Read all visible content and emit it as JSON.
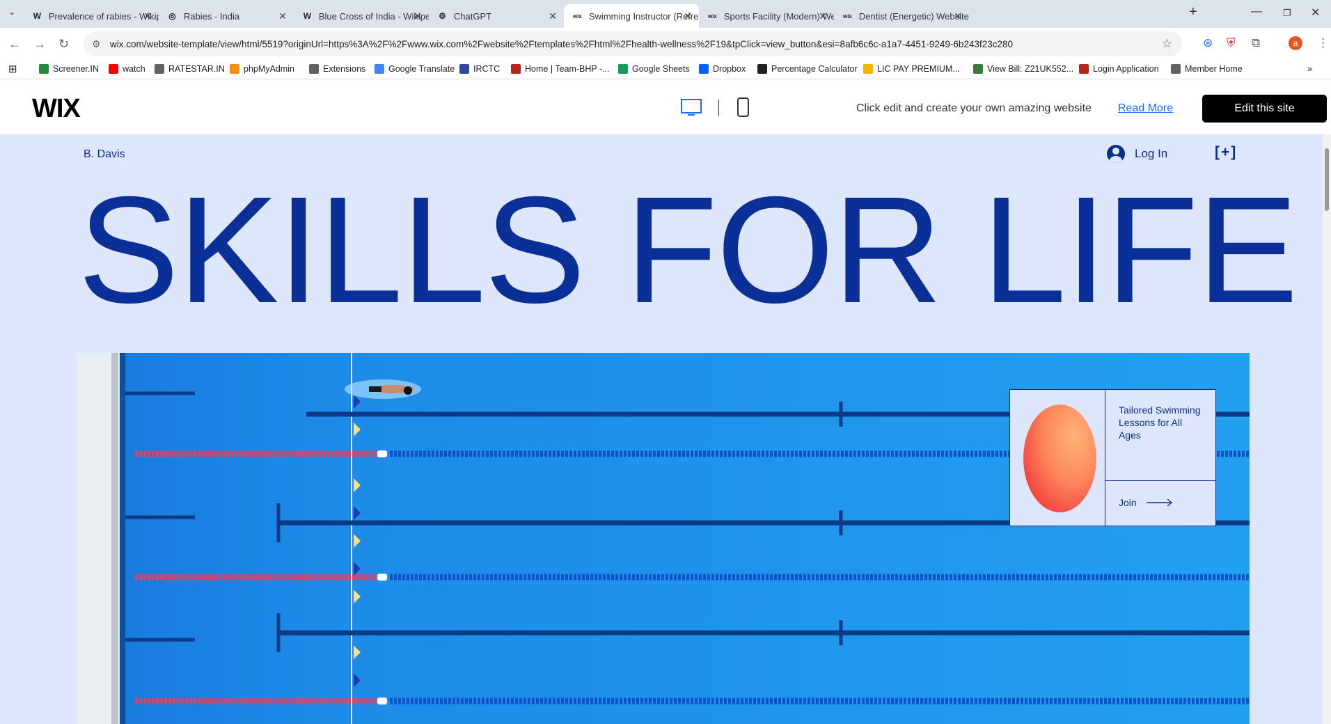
{
  "browser": {
    "tabs": [
      {
        "title": "Prevalence of rabies - Wikipedia",
        "icon": "wikipedia-icon",
        "glyph": "W"
      },
      {
        "title": "Rabies - India",
        "icon": "globe-icon",
        "glyph": "◎"
      },
      {
        "title": "Blue Cross of India - Wikipedia",
        "icon": "wikipedia-icon",
        "glyph": "W"
      },
      {
        "title": "ChatGPT",
        "icon": "chatgpt-icon",
        "glyph": "⚙"
      },
      {
        "title": "Swimming Instructor (Refreshing)",
        "icon": "wix-icon",
        "glyph": "wix",
        "active": true
      },
      {
        "title": "Sports Facility (Modern) Website",
        "icon": "wix-icon",
        "glyph": "wix"
      },
      {
        "title": "Dentist (Energetic) Website Template",
        "icon": "wix-icon",
        "glyph": "wix"
      }
    ],
    "url": "wix.com/website-template/view/html/5519?originUrl=https%3A%2F%2Fwww.wix.com%2Fwebsite%2Ftemplates%2Fhtml%2Fhealth-wellness%2F19&tpClick=view_button&esi=8afb6c6c-a1a7-4451-9249-6b243f23c280",
    "profile_initial": "a",
    "bookmarks": [
      {
        "label": "Screener.IN",
        "color": "#1e8e3e"
      },
      {
        "label": "watch",
        "color": "#ff0000"
      },
      {
        "label": "RATESTAR.IN",
        "color": "#5f6368"
      },
      {
        "label": "phpMyAdmin",
        "color": "#f29111"
      },
      {
        "label": "Extensions",
        "color": "#5f6368"
      },
      {
        "label": "Google Translate",
        "color": "#4285f4"
      },
      {
        "label": "IRCTC",
        "color": "#2b4a9b"
      },
      {
        "label": "Home | Team-BHP -...",
        "color": "#b3261e"
      },
      {
        "label": "Google Sheets",
        "color": "#0f9d58"
      },
      {
        "label": "Dropbox",
        "color": "#0061ff"
      },
      {
        "label": "Percentage Calculator",
        "color": "#202124"
      },
      {
        "label": "LIC PAY PREMIUM...",
        "color": "#f4b400"
      },
      {
        "label": "View Bill: Z21UK552...",
        "color": "#3b7a3b"
      },
      {
        "label": "Login Application",
        "color": "#b3261e"
      },
      {
        "label": "Member Home",
        "color": "#5f6368"
      }
    ]
  },
  "wix": {
    "logo": "WIX",
    "message": "Click edit and create your own amazing website",
    "read_more": "Read More",
    "edit_button": "Edit this site"
  },
  "site": {
    "brand": "B. Davis",
    "login": "Log In",
    "cart": "[+]",
    "hero_title": "SKILLS FOR LIFE",
    "card_text": "Tailored Swimming Lessons for All Ages",
    "card_join": "Join"
  },
  "colors": {
    "site_bg": "#dde6fb",
    "brand_blue": "#0a2f96",
    "pool_blue": "#1b96ec"
  }
}
